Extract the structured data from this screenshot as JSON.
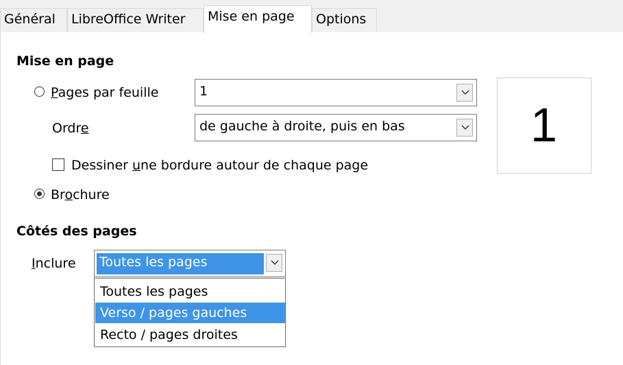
{
  "tabs": [
    {
      "label": "Général"
    },
    {
      "label": "LibreOffice Writer"
    },
    {
      "label": "Mise en page"
    },
    {
      "label": "Options"
    }
  ],
  "active_tab": "Mise en page",
  "layout": {
    "heading": "Mise en page",
    "pages_per_sheet": {
      "label_pre": "",
      "label_u": "P",
      "label_post": "ages par feuille",
      "selected": false,
      "value": "1"
    },
    "order": {
      "label_pre": "Ordr",
      "label_u": "e",
      "label_post": "",
      "value": "de gauche à droite, puis en bas"
    },
    "border": {
      "label_pre": "Dessiner ",
      "label_u": "u",
      "label_post": "ne bordure autour de chaque page",
      "checked": false
    },
    "brochure": {
      "label_pre": "Br",
      "label_u": "o",
      "label_post": "chure",
      "selected": true
    },
    "preview_number": "1"
  },
  "page_sides": {
    "heading": "Côtés des pages",
    "include": {
      "label_u": "I",
      "label_post": "nclure",
      "value": "Toutes les pages"
    },
    "options": [
      {
        "label": "Toutes les pages"
      },
      {
        "label": "Verso / pages gauches"
      },
      {
        "label": "Recto / pages droites"
      }
    ],
    "highlighted_option": "Verso / pages gauches"
  },
  "colors": {
    "selection": "#3e94e7",
    "tab_bg": "#f0f0f0",
    "border": "#d9d9d9"
  },
  "icons": [
    "chevron-down-icon",
    "radio-icon",
    "checkbox-icon"
  ]
}
